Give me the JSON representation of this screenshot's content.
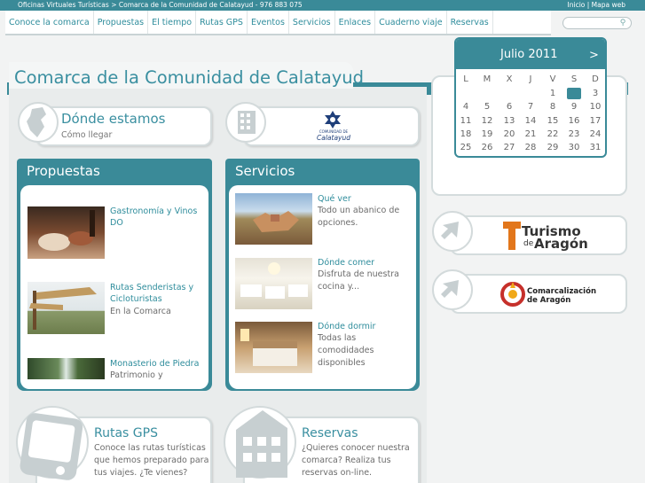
{
  "topbar": {
    "breadcrumb": "Oficinas Virtuales Turísticas > Comarca de la Comunidad de Calatayud - 976 883 075",
    "links": "Inicio | Mapa web"
  },
  "nav": {
    "items": [
      "Conoce la comarca",
      "Propuestas",
      "El tiempo",
      "Rutas GPS",
      "Eventos",
      "Servicios",
      "Enlaces",
      "Cuaderno viaje",
      "Reservas"
    ]
  },
  "page": {
    "title": "Comarca de la Comunidad de Calatayud"
  },
  "donde": {
    "title": "Dónde estamos",
    "sub": "Cómo llegar"
  },
  "logo": {
    "text": "Calatayud",
    "small": "COMUNIDAD DE"
  },
  "propuestas": {
    "heading": "Propuestas",
    "items": [
      {
        "title": "Gastronomía y Vinos DO",
        "text": ""
      },
      {
        "title": "Rutas Senderistas y Cicloturistas",
        "text": "En la Comarca"
      },
      {
        "title": "Monasterio de Piedra",
        "text": "Patrimonio y"
      }
    ]
  },
  "servicios": {
    "heading": "Servicios",
    "items": [
      {
        "title": "Qué ver",
        "text": "Todo un abanico de opciones."
      },
      {
        "title": "Dónde comer",
        "text": "Disfruta de nuestra cocina y..."
      },
      {
        "title": "Dónde dormir",
        "text": "Todas las comodidades disponibles"
      }
    ]
  },
  "rutas": {
    "title": "Rutas GPS",
    "text": "Conoce las rutas turísticas que hemos preparado para tus viajes. ¿Te vienes?"
  },
  "reservas": {
    "title": "Reservas",
    "text": "¿Quieres conocer nuestra comarca? Realiza tus reservas on-line."
  },
  "calendar": {
    "month": "Julio 2011",
    "next": ">",
    "days": [
      "L",
      "M",
      "X",
      "J",
      "V",
      "S",
      "D"
    ],
    "weeks": [
      [
        "",
        "",
        "",
        "",
        "1",
        "2",
        "3"
      ],
      [
        "4",
        "5",
        "6",
        "7",
        "8",
        "9",
        "10"
      ],
      [
        "11",
        "12",
        "13",
        "14",
        "15",
        "16",
        "17"
      ],
      [
        "18",
        "19",
        "20",
        "21",
        "22",
        "23",
        "24"
      ],
      [
        "25",
        "26",
        "27",
        "28",
        "29",
        "30",
        "31"
      ]
    ],
    "today": "2"
  },
  "sponsors": {
    "turismo": {
      "word1": "Turismo",
      "de": "de",
      "word2": "Aragón"
    },
    "comarcalizacion": {
      "line1": "Comarcalización",
      "line2": "de Aragón"
    }
  },
  "colors": {
    "accent": "#3a8a98",
    "link": "#2f8d9c"
  }
}
